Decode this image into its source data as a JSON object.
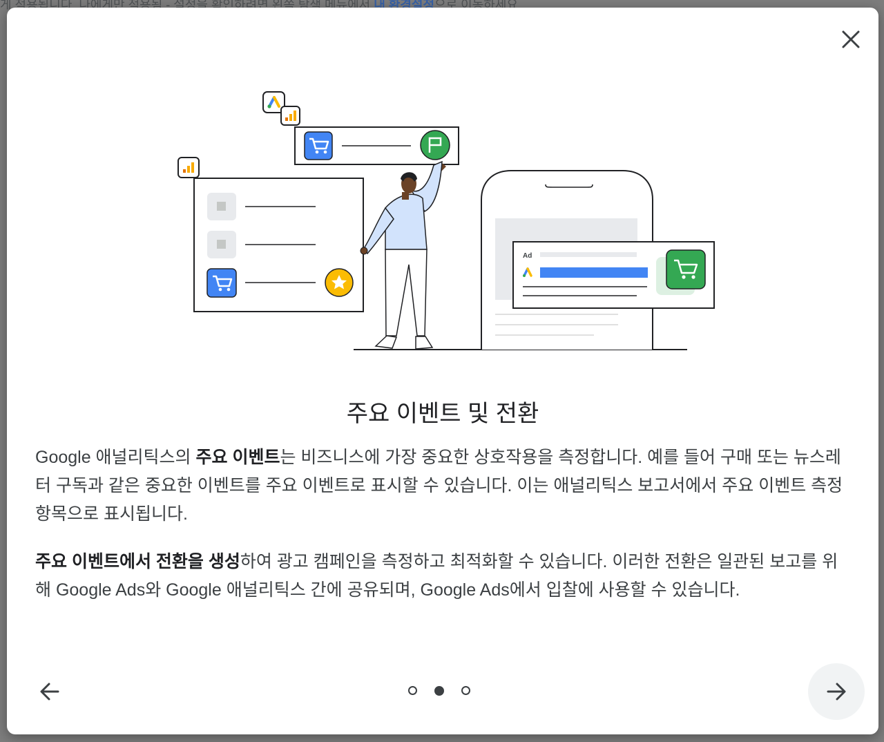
{
  "backdrop": {
    "text_before": "게 적용됩니다. 나에게만 적용됨 - 설정을 확인하려면 왼쪽 탐색 메뉴에서 ",
    "link": "내 환경설정",
    "text_after": "으로 이동하세요."
  },
  "illustration": {
    "ad_label": "Ad",
    "colors": {
      "blue": "#4285f4",
      "green": "#34a853",
      "yellow": "#fbbc04",
      "orange": "#f29900"
    }
  },
  "dialog": {
    "title": "주요 이벤트 및 전환",
    "p1": {
      "before": "Google 애널리틱스의 ",
      "bold": "주요 이벤트",
      "after": "는 비즈니스에 가장 중요한 상호작용을 측정합니다. 예를 들어 구매 또는 뉴스레터 구독과 같은 중요한 이벤트를 주요 이벤트로 표시할 수 있습니다. 이는 애널리틱스 보고서에서 주요 이벤트 측정항목으로 표시됩니다."
    },
    "p2": {
      "bold": "주요 이벤트에서 전환을 생성",
      "after": "하여 광고 캠페인을 측정하고 최적화할 수 있습니다. 이러한 전환은 일관된 보고를 위해 Google Ads와 Google 애널리틱스 간에 공유되며, Google Ads에서 입찰에 사용할 수 있습니다."
    }
  },
  "pager": {
    "total": 3,
    "current": 2
  },
  "icons": {
    "close": "close-icon",
    "prev": "arrow-left-icon",
    "next": "arrow-right-icon",
    "cart": "cart-icon",
    "flag": "flag-icon",
    "star": "star-icon",
    "ads_logo": "google-ads-icon",
    "analytics_logo": "analytics-icon"
  }
}
